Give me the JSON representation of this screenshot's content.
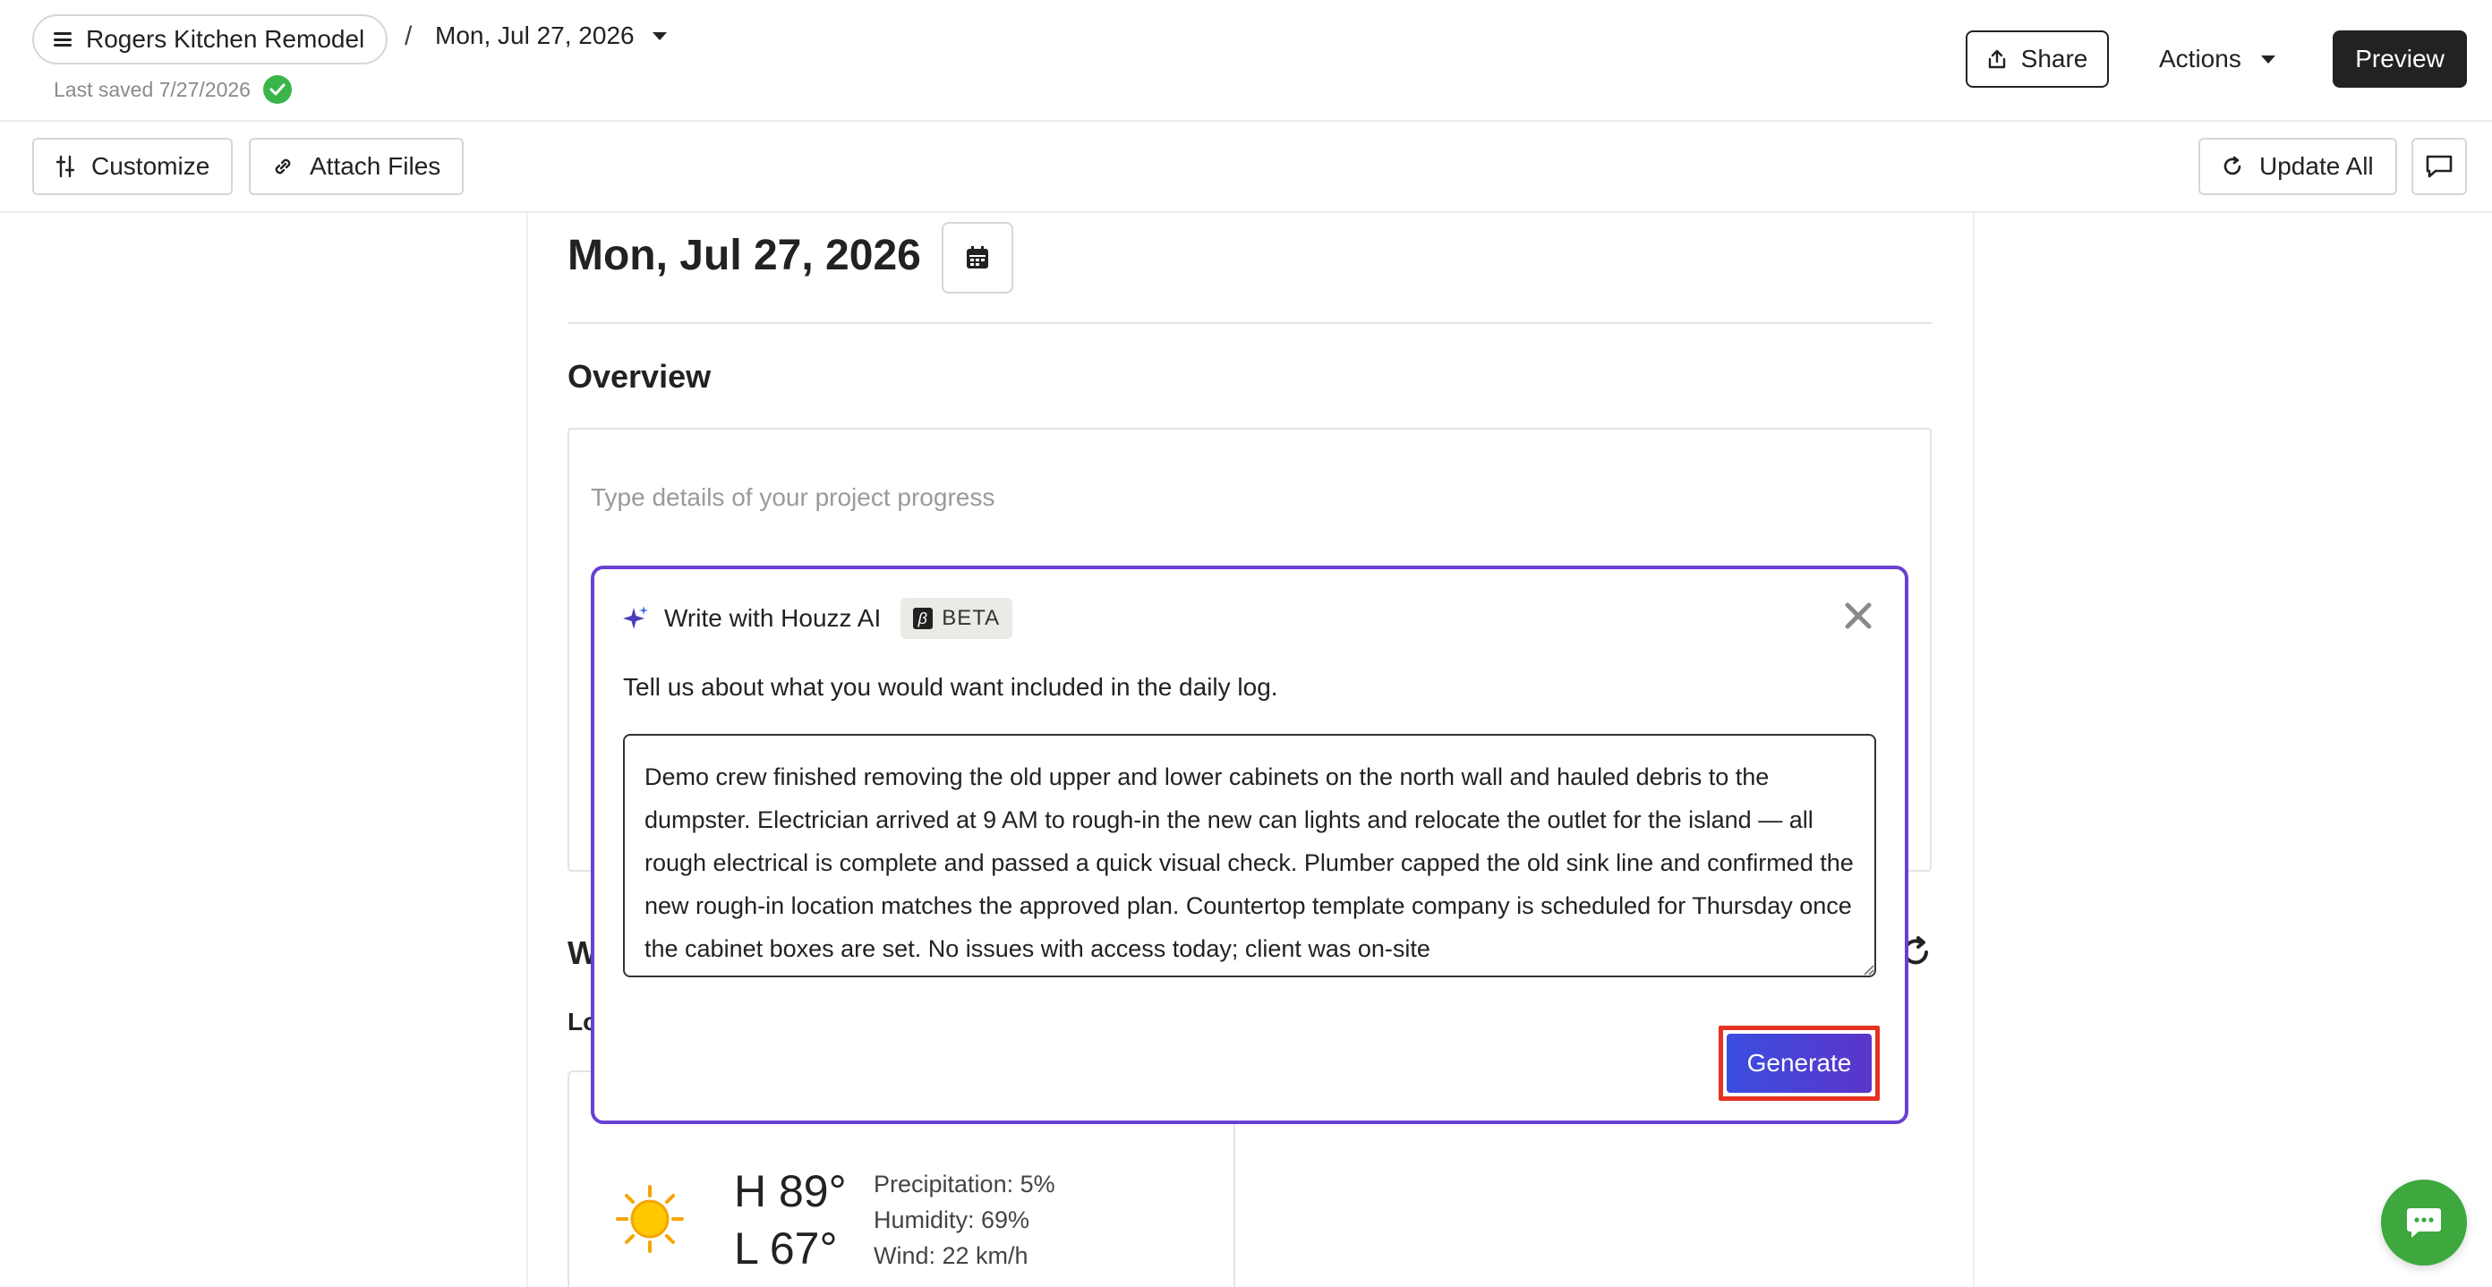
{
  "header": {
    "project_name": "Rogers Kitchen Remodel",
    "breadcrumb_separator": "/",
    "log_date": "Mon, Jul 27, 2026",
    "last_saved": "Last saved 7/27/2026",
    "share_label": "Share",
    "actions_label": "Actions",
    "preview_label": "Preview"
  },
  "toolbar": {
    "customize_label": "Customize",
    "attach_label": "Attach Files",
    "update_all_label": "Update All"
  },
  "main": {
    "date_title": "Mon, Jul 27, 2026",
    "overview_title": "Overview",
    "overview_placeholder": "Type details of your project progress",
    "weather_title_partial": "W",
    "location_label_partial": "Lo",
    "weather": {
      "high": "H 89°",
      "low": "L 67°",
      "precipitation": "Precipitation: 5%",
      "humidity": "Humidity: 69%",
      "wind": "Wind: 22 km/h"
    }
  },
  "ai_modal": {
    "title": "Write with Houzz AI",
    "beta_glyph": "β",
    "beta_label": "BETA",
    "prompt": "Tell us about what you would want included in the daily log.",
    "input_value": "Demo crew finished removing the old upper and lower cabinets on the north wall and hauled debris to the dumpster. Electrician arrived at 9 AM to rough-in the new can lights and relocate the outlet for the island — all rough electrical is complete and passed a quick visual check. Plumber capped the old sink line and confirmed the new rough-in location matches the approved plan. Countertop template company is scheduled for Thursday once the cabinet boxes are set. No issues with access today; client was on-site",
    "generate_label": "Generate"
  },
  "colors": {
    "accent_purple": "#6a3fd3",
    "generate_gradient_start": "#3a4ee0",
    "generate_gradient_end": "#5b35c9",
    "highlight_red": "#e53222",
    "success_green": "#3ab54a",
    "chat_green": "#3ca83e"
  },
  "icons": {
    "menu": "hamburger-icon",
    "saved": "check-circle-icon",
    "share": "share-icon",
    "customize": "sliders-icon",
    "attach": "paperclip-icon",
    "update": "refresh-icon",
    "comment": "comment-icon",
    "calendar": "calendar-icon",
    "ai": "sparkle-icon",
    "close": "close-icon",
    "weather": "sun-icon",
    "chat": "chat-icon"
  }
}
